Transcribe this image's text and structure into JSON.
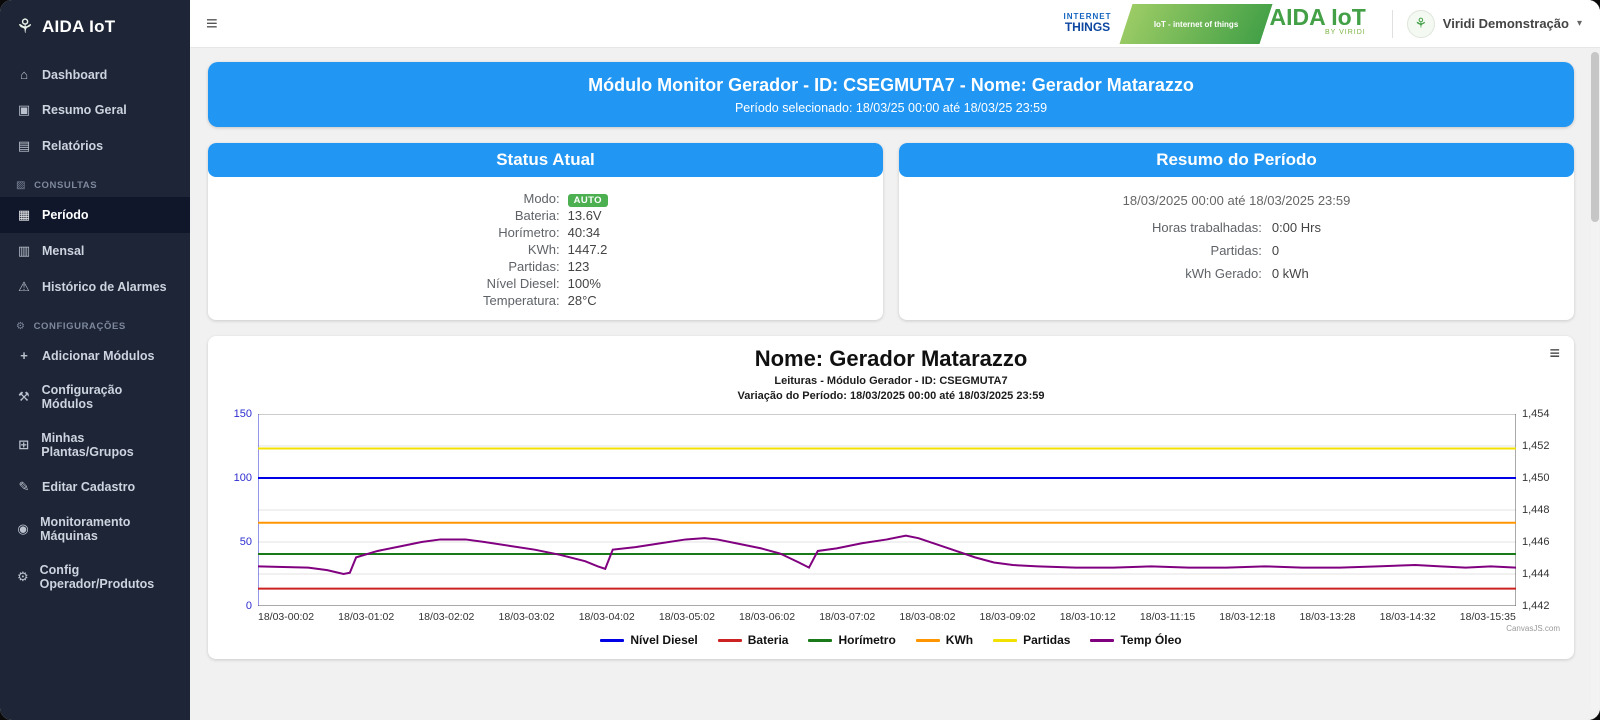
{
  "colors": {
    "accent_blue": "#2196f3",
    "sidebar_bg": "#1d2536",
    "badge_green": "#4caf50",
    "brand_green": "#43a047"
  },
  "icons": {
    "menu": "≡",
    "caret": "▾",
    "plant": "⚘",
    "home": "⌂",
    "summary": "▣",
    "reports": "▤",
    "consultas": "▨",
    "period": "▦",
    "monthly": "▥",
    "alarm": "⚠",
    "gear": "⚙",
    "add": "+",
    "tools": "⚒",
    "groups": "⊞",
    "edit": "✎",
    "monitor": "◉",
    "operator": "⚙",
    "chartmenu": "≡"
  },
  "sidebar": {
    "logo": "AIDA IoT",
    "items": [
      "Dashboard",
      "Resumo Geral",
      "Relatórios"
    ],
    "section_consultas": "CONSULTAS",
    "items_consultas": [
      "Período",
      "Mensal",
      "Histórico de Alarmes"
    ],
    "section_config": "CONFIGURAÇÕES",
    "items_config": [
      "Adicionar Módulos",
      "Configuração Módulos",
      "Minhas Plantas/Grupos",
      "Editar Cadastro",
      "Monitoramento Máquinas",
      "Config Operador/Produtos"
    ]
  },
  "header": {
    "cloud_line1": "INTERNET",
    "cloud_line2": "THINGS",
    "strip_text": "IoT - internet of things",
    "brand": "AIDA IoT",
    "brand_sub": "BY VIRIDI",
    "user": "Viridi Demonstração"
  },
  "banner": {
    "title": "Módulo Monitor Gerador - ID: CSEGMUTA7 - Nome: Gerador Matarazzo",
    "subtitle": "Período selecionado: 18/03/25 00:00 até 18/03/25 23:59"
  },
  "status": {
    "title": "Status Atual",
    "rows": [
      {
        "label": "Modo:",
        "value": "AUTO"
      },
      {
        "label": "Bateria:",
        "value": "13.6V"
      },
      {
        "label": "Horímetro:",
        "value": "40:34"
      },
      {
        "label": "KWh:",
        "value": "1447.2"
      },
      {
        "label": "Partidas:",
        "value": "123"
      },
      {
        "label": "Nível Diesel:",
        "value": "100%"
      },
      {
        "label": "Temperatura:",
        "value": "28°C"
      }
    ]
  },
  "resumo": {
    "title": "Resumo do Período",
    "period": "18/03/2025 00:00 até 18/03/2025 23:59",
    "rows": [
      {
        "label": "Horas trabalhadas:",
        "value": "0:00 Hrs"
      },
      {
        "label": "Partidas:",
        "value": "0"
      },
      {
        "label": "kWh Gerado:",
        "value": "0 kWh"
      }
    ]
  },
  "chart_data": {
    "type": "line",
    "title": "Nome: Gerador Matarazzo",
    "subtitle1": "Leituras - Módulo Gerador - ID: CSEGMUTA7",
    "subtitle2": "Variação do Período: 18/03/2025 00:00 até 18/03/2025 23:59",
    "x_labels": [
      "18/03-00:02",
      "18/03-01:02",
      "18/03-02:02",
      "18/03-03:02",
      "18/03-04:02",
      "18/03-05:02",
      "18/03-06:02",
      "18/03-07:02",
      "18/03-08:02",
      "18/03-09:02",
      "18/03-10:12",
      "18/03-11:15",
      "18/03-12:18",
      "18/03-13:28",
      "18/03-14:32",
      "18/03-15:35"
    ],
    "left_axis": {
      "min": 0,
      "max": 150,
      "tick_labels": [
        "150",
        "100",
        "50",
        "0"
      ],
      "color": "#2d2dd0"
    },
    "right_axis": {
      "min": 1442,
      "max": 1454,
      "tick_labels": [
        "1,454",
        "1,452",
        "1,450",
        "1,448",
        "1,446",
        "1,444",
        "1,442"
      ]
    },
    "grid": true,
    "legend_position": "bottom",
    "series": [
      {
        "name": "Nível Diesel",
        "color": "#0000e6",
        "axis": "left",
        "constant": 100
      },
      {
        "name": "Bateria",
        "color": "#cc2222",
        "axis": "left",
        "constant": 13.6
      },
      {
        "name": "Horímetro",
        "color": "#1a7a1a",
        "axis": "left",
        "constant": 40.6
      },
      {
        "name": "KWh",
        "color": "#ff9500",
        "axis": "right",
        "constant": 1447.2
      },
      {
        "name": "Partidas",
        "color": "#f2e000",
        "axis": "left",
        "constant": 123
      },
      {
        "name": "Temp Óleo",
        "color": "#800080",
        "axis": "left",
        "points": [
          [
            0,
            31
          ],
          [
            2,
            30.5
          ],
          [
            4,
            30
          ],
          [
            5.5,
            28
          ],
          [
            6.8,
            25
          ],
          [
            7.3,
            26
          ],
          [
            7.8,
            38
          ],
          [
            9.5,
            43
          ],
          [
            11.5,
            47
          ],
          [
            13,
            50
          ],
          [
            14.5,
            52
          ],
          [
            16.5,
            52
          ],
          [
            18,
            50
          ],
          [
            20,
            47
          ],
          [
            22,
            44
          ],
          [
            24,
            40
          ],
          [
            26,
            35
          ],
          [
            27,
            31
          ],
          [
            27.6,
            29
          ],
          [
            28.2,
            44
          ],
          [
            30,
            46
          ],
          [
            32,
            49
          ],
          [
            34,
            52
          ],
          [
            35.5,
            53
          ],
          [
            36.5,
            52
          ],
          [
            38,
            49
          ],
          [
            40,
            45
          ],
          [
            41.5,
            41
          ],
          [
            43,
            34
          ],
          [
            43.8,
            30
          ],
          [
            44.5,
            43
          ],
          [
            46,
            45
          ],
          [
            48,
            49
          ],
          [
            50,
            52
          ],
          [
            51.5,
            55
          ],
          [
            52.5,
            53
          ],
          [
            54,
            48
          ],
          [
            55.5,
            43
          ],
          [
            57,
            38
          ],
          [
            58.5,
            34
          ],
          [
            60,
            32
          ],
          [
            62,
            31
          ],
          [
            65,
            30
          ],
          [
            68,
            30
          ],
          [
            71,
            31
          ],
          [
            74,
            30
          ],
          [
            77,
            30
          ],
          [
            80,
            31
          ],
          [
            83,
            30
          ],
          [
            86,
            30
          ],
          [
            89,
            31
          ],
          [
            92,
            32
          ],
          [
            94,
            31
          ],
          [
            96,
            30
          ],
          [
            98,
            31
          ],
          [
            100,
            30
          ]
        ]
      }
    ],
    "watermark": "CanvasJS.com"
  }
}
